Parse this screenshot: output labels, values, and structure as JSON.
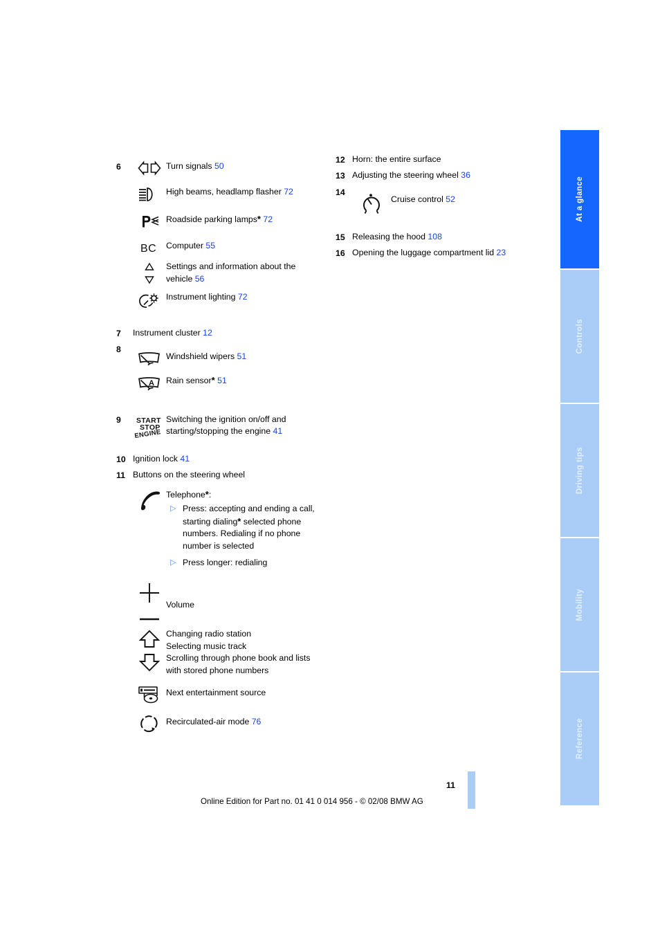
{
  "document": {
    "page_number": "11",
    "footer_text": "Online Edition for Part no. 01 41 0 014 956 - © 02/08 BMW AG"
  },
  "colors": {
    "tab_active": "#1565ff",
    "tab_inactive": "#aacdf7",
    "page_reference_link": "#1a41f0",
    "bullet": "#4f8ff0"
  },
  "tab_rail": {
    "tabs": [
      {
        "label": "At a glance",
        "active": true
      },
      {
        "label": "Controls",
        "active": false
      },
      {
        "label": "Driving tips",
        "active": false
      },
      {
        "label": "Mobility",
        "active": false
      },
      {
        "label": "Reference",
        "active": false
      }
    ]
  },
  "left_column": {
    "group6": {
      "number": "6",
      "entries": [
        {
          "icon": "turn-signals-icon",
          "label": "Turn signals",
          "page": "50"
        },
        {
          "icon": "high-beams-icon",
          "label": "High beams, headlamp flasher",
          "page": "72"
        },
        {
          "icon": "roadside-parking-lamps-icon",
          "label": "Roadside parking lamps",
          "optional": "*",
          "page": "72"
        },
        {
          "icon": "onboard-computer-bc-icon",
          "label": "Computer",
          "page": "55"
        },
        {
          "icon": "up-down-triangles-icon",
          "label": "Settings and information about the vehicle",
          "page": "56"
        },
        {
          "icon": "instrument-lighting-icon",
          "label": "Instrument lighting",
          "page": "72"
        }
      ]
    },
    "item7": {
      "number": "7",
      "label": "Instrument cluster",
      "page": "12"
    },
    "group8": {
      "number": "8",
      "entries": [
        {
          "icon": "windshield-wipers-icon",
          "label": "Windshield wipers",
          "page": "51"
        },
        {
          "icon": "rain-sensor-icon",
          "label": "Rain sensor",
          "optional": "*",
          "page": "51"
        }
      ]
    },
    "item9": {
      "number": "9",
      "icon": "start-stop-engine-icon",
      "label": "Switching the ignition on/off and starting/stopping the engine",
      "page": "41"
    },
    "item10": {
      "number": "10",
      "label": "Ignition lock",
      "page": "41"
    },
    "item11": {
      "number": "11",
      "label": "Buttons on the steering wheel",
      "entries": [
        {
          "icon": "telephone-handset-icon",
          "label": "Telephone",
          "optional": "*",
          "suffix": ":",
          "bullets": [
            {
              "marker": "▷",
              "text_parts": [
                "Press: accepting and ending a call, starting dialing",
                "*",
                " selected phone numbers. Redialing if no phone number is selected"
              ]
            },
            {
              "marker": "▷",
              "text_parts": [
                "Press longer: redialing"
              ]
            }
          ]
        },
        {
          "icon": "volume-plus-minus-icon",
          "label": "Volume"
        },
        {
          "icon": "up-down-arrows-icon",
          "lines": [
            "Changing radio station",
            "Selecting music track",
            "Scrolling through phone book and lists with stored phone numbers"
          ]
        },
        {
          "icon": "entertainment-source-icon",
          "label": "Next entertainment source"
        },
        {
          "icon": "recirculated-air-icon",
          "label": "Recirculated-air mode",
          "page": "76"
        }
      ]
    }
  },
  "right_column": {
    "item12": {
      "number": "12",
      "label": "Horn: the entire surface"
    },
    "item13": {
      "number": "13",
      "label": "Adjusting the steering wheel",
      "page": "36"
    },
    "item14": {
      "number": "14",
      "icon": "cruise-control-icon",
      "label": "Cruise control",
      "page": "52"
    },
    "item15": {
      "number": "15",
      "label": "Releasing the hood",
      "page": "108"
    },
    "item16": {
      "number": "16",
      "label": "Opening the luggage compartment lid",
      "page": "23"
    }
  }
}
